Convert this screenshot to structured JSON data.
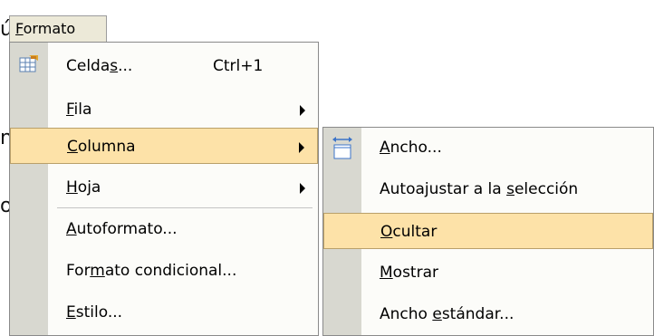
{
  "background": {
    "left_fragments": [
      "ú",
      "n",
      "o"
    ]
  },
  "menubar": {
    "title_pre": "",
    "title_u": "F",
    "title_post": "ormato"
  },
  "main_menu": {
    "items": [
      {
        "pre": "Celda",
        "u": "s",
        "post": "...",
        "shortcut": "Ctrl+1",
        "icon": "cells-format-icon"
      },
      {
        "pre": "",
        "u": "F",
        "post": "ila",
        "submenu": true
      },
      {
        "pre": "",
        "u": "C",
        "post": "olumna",
        "submenu": true,
        "highlighted": true
      },
      {
        "pre": "",
        "u": "H",
        "post": "oja",
        "submenu": true
      },
      {
        "pre": "",
        "u": "A",
        "post": "utoformato..."
      },
      {
        "pre": "For",
        "u": "m",
        "post": "ato condicional..."
      },
      {
        "pre": "",
        "u": "E",
        "post": "stilo..."
      }
    ]
  },
  "submenu": {
    "items": [
      {
        "pre": "",
        "u": "A",
        "post": "ncho...",
        "icon": "column-width-icon"
      },
      {
        "pre": "Autoajustar a la ",
        "u": "s",
        "post": "elección"
      },
      {
        "pre": "",
        "u": "O",
        "post": "cultar",
        "highlighted": true
      },
      {
        "pre": "",
        "u": "M",
        "post": "ostrar"
      },
      {
        "pre": "Ancho ",
        "u": "e",
        "post": "stándar..."
      }
    ]
  },
  "colors": {
    "highlight": "#fde2a8",
    "strip": "#d8d8d0",
    "menu_bg": "#fcfcf9"
  }
}
